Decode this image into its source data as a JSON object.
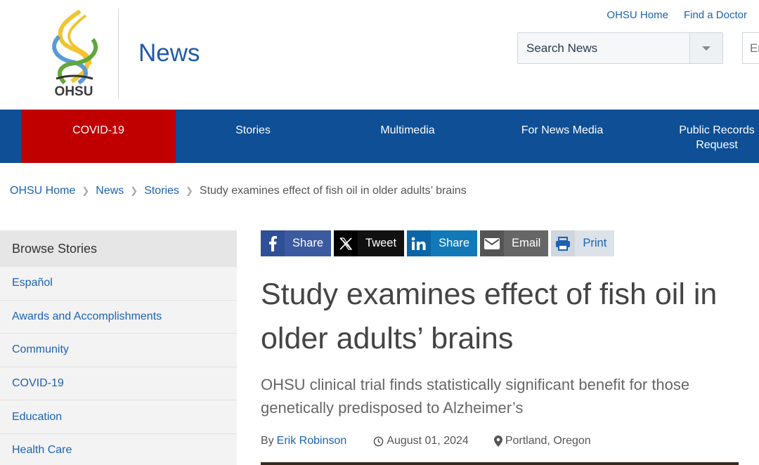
{
  "header": {
    "logo_text": "OHSU",
    "site_title": "News",
    "util_links": [
      "OHSU Home",
      "Find a Doctor"
    ],
    "search_scope": "Search News",
    "search_placeholder": "Enter search"
  },
  "nav": {
    "items": [
      {
        "label": "COVID-19",
        "active": true
      },
      {
        "label": "Stories"
      },
      {
        "label": "Multimedia"
      },
      {
        "label": "For News Media"
      },
      {
        "label": "Public Records Request"
      }
    ]
  },
  "breadcrumb": {
    "items": [
      "OHSU Home",
      "News",
      "Stories"
    ],
    "current": "Study examines effect of fish oil in older adults’ brains"
  },
  "sidebar": {
    "heading": "Browse Stories",
    "items": [
      "Español",
      "Awards and Accomplishments",
      "Community",
      "COVID-19",
      "Education",
      "Health Care"
    ]
  },
  "share": {
    "facebook": "Share",
    "x": "Tweet",
    "linkedin": "Share",
    "email": "Email",
    "print": "Print"
  },
  "article": {
    "headline": "Study examines effect of fish oil in older adults’ brains",
    "subhead": "OHSU clinical trial finds statistically significant benefit for those genetically predisposed to Alzheimer’s",
    "by_prefix": "By",
    "author": "Erik Robinson",
    "date": "August 01, 2024",
    "location": "Portland, Oregon"
  },
  "colors": {
    "nav_bg": "#0e4f96",
    "nav_active": "#c00000",
    "link": "#1b62b5"
  }
}
